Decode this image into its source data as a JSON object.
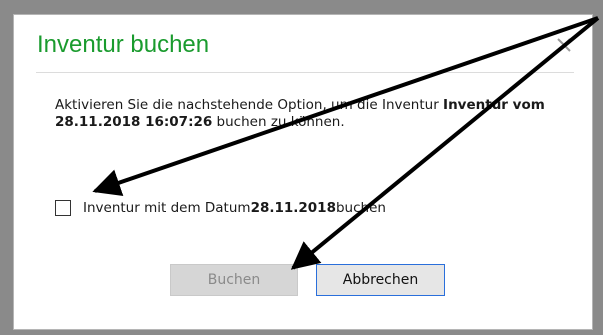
{
  "dialog": {
    "title": "Inventur buchen",
    "message_part1": "Aktivieren Sie die nachstehende Option, um die Inventur ",
    "message_bold": "Inventur vom 28.11.2018 16:07:26",
    "message_part2": " buchen zu  können.",
    "option_prefix": "Inventur mit dem Datum ",
    "option_date": "28.11.2018",
    "option_suffix": " buchen",
    "book_label": "Buchen",
    "cancel_label": "Abbrechen"
  },
  "colors": {
    "title": "#1a9b2e",
    "annotation_arrows": "#000000"
  },
  "icons": {
    "close": "close-icon",
    "checkbox": "checkbox-unchecked"
  }
}
